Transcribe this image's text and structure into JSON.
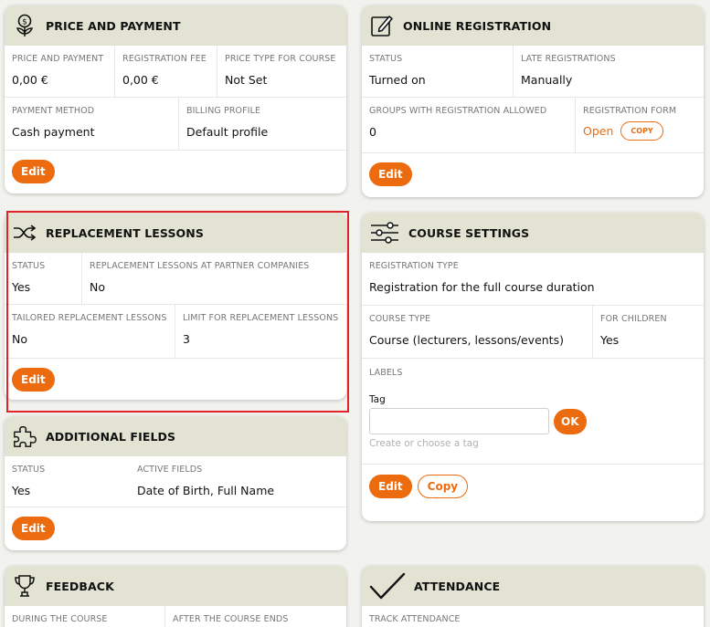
{
  "price": {
    "title": "PRICE AND PAYMENT",
    "fields": [
      {
        "label": "PRICE AND PAYMENT",
        "value": "0,00 €"
      },
      {
        "label": "REGISTRATION FEE",
        "value": "0,00 €"
      },
      {
        "label": "PRICE TYPE FOR COURSE",
        "value": "Not Set"
      },
      {
        "label": "PAYMENT METHOD",
        "value": "Cash payment"
      },
      {
        "label": "BILLING PROFILE",
        "value": "Default profile"
      }
    ],
    "edit_label": "Edit"
  },
  "online": {
    "title": "ONLINE REGISTRATION",
    "fields": [
      {
        "label": "STATUS",
        "value": "Turned on"
      },
      {
        "label": "LATE REGISTRATIONS",
        "value": "Manually"
      },
      {
        "label": "GROUPS WITH REGISTRATION ALLOWED",
        "value": "0"
      },
      {
        "label": "REGISTRATION FORM",
        "value": "Open"
      }
    ],
    "copy_small": "COPY",
    "edit_label": "Edit"
  },
  "replacement": {
    "title": "REPLACEMENT LESSONS",
    "fields": [
      {
        "label": "STATUS",
        "value": "Yes"
      },
      {
        "label": "REPLACEMENT LESSONS AT PARTNER COMPANIES",
        "value": "No"
      },
      {
        "label": "TAILORED REPLACEMENT LESSONS",
        "value": "No"
      },
      {
        "label": "LIMIT FOR REPLACEMENT LESSONS",
        "value": "3"
      }
    ],
    "edit_label": "Edit"
  },
  "settings": {
    "title": "COURSE SETTINGS",
    "fields": [
      {
        "label": "REGISTRATION TYPE",
        "value": "Registration for the full course duration"
      },
      {
        "label": "COURSE TYPE",
        "value": "Course (lecturers, lessons/events)"
      },
      {
        "label": "FOR CHILDREN",
        "value": "Yes"
      }
    ],
    "labels_label": "LABELS",
    "tag_label": "Tag",
    "tag_value": "",
    "ok_label": "OK",
    "tag_hint": "Create or choose a tag",
    "edit_label": "Edit",
    "copy_label": "Copy"
  },
  "additional": {
    "title": "ADDITIONAL FIELDS",
    "fields": [
      {
        "label": "STATUS",
        "value": "Yes"
      },
      {
        "label": "ACTIVE FIELDS",
        "value": "Date of Birth, Full Name"
      }
    ],
    "edit_label": "Edit"
  },
  "feedback": {
    "title": "FEEDBACK",
    "fields": [
      {
        "label": "DURING THE COURSE"
      },
      {
        "label": "AFTER THE COURSE ENDS"
      }
    ]
  },
  "attendance": {
    "title": "ATTENDANCE",
    "fields": [
      {
        "label": "TRACK ATTENDANCE"
      }
    ]
  },
  "colors": {
    "accent": "#ec6b0e",
    "header": "#e2e3d2",
    "highlight": "#e0242a"
  }
}
